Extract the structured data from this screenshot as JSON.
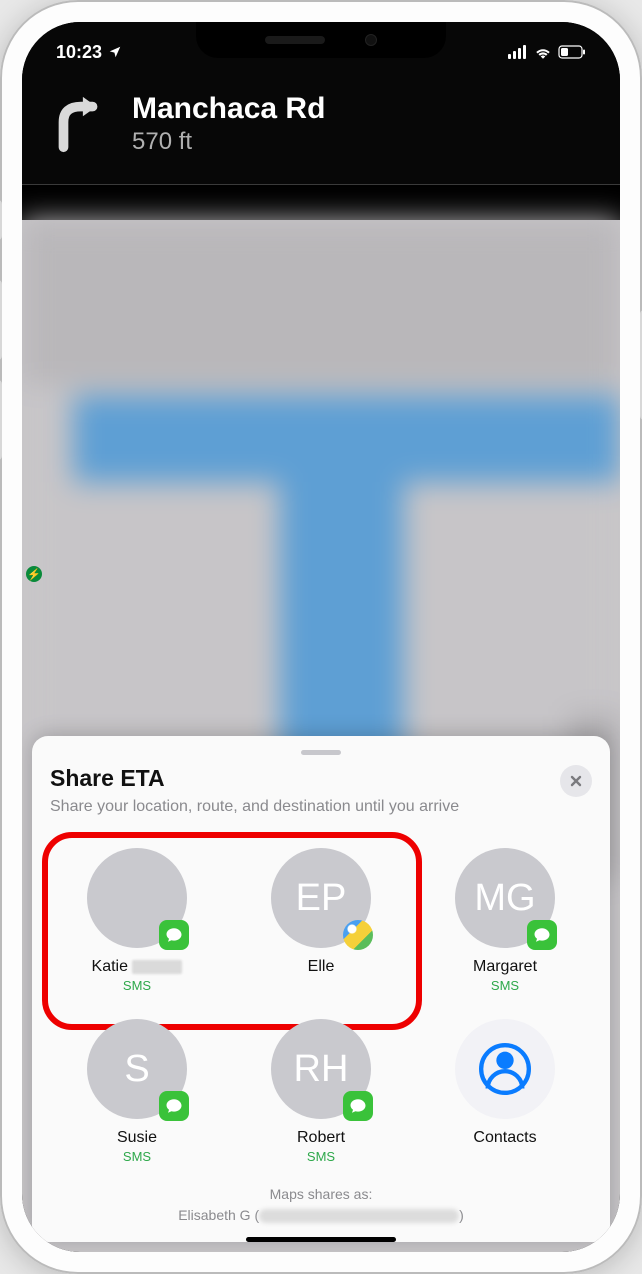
{
  "status": {
    "time": "10:23",
    "location_arrow": "↗"
  },
  "nav": {
    "road": "Manchaca Rd",
    "distance": "570 ft"
  },
  "sheet": {
    "title": "Share ETA",
    "subtitle": "Share your location, route, and destination until you arrive"
  },
  "contacts": [
    {
      "name": "Katie",
      "initials": "",
      "photo": true,
      "sms": "SMS",
      "badge": "green"
    },
    {
      "name": "Elle",
      "initials": "EP",
      "photo": false,
      "sms": "",
      "badge": "maps"
    },
    {
      "name": "Margaret",
      "initials": "MG",
      "photo": false,
      "sms": "SMS",
      "badge": "green"
    },
    {
      "name": "Susie",
      "initials": "S",
      "photo": false,
      "sms": "SMS",
      "badge": "green"
    },
    {
      "name": "Robert",
      "initials": "RH",
      "photo": false,
      "sms": "SMS",
      "badge": "green"
    },
    {
      "name": "Contacts",
      "initials": "",
      "photo": false,
      "sms": "",
      "badge": "",
      "app": true
    }
  ],
  "share_as": {
    "label": "Maps shares as:",
    "name": "Elisabeth G"
  }
}
